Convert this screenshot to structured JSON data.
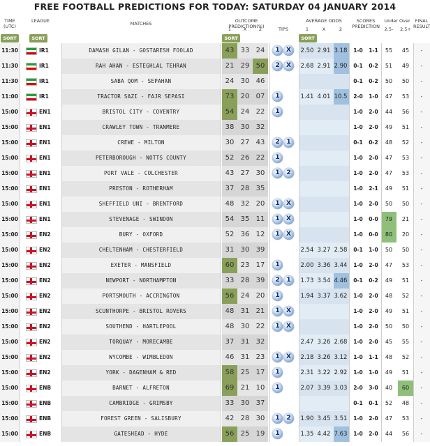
{
  "title": "FREE FOOTBALL PREDICTIONS FOR TODAY: SATURDAY 04 JANUARY 2014",
  "headers": {
    "time": "TIME",
    "utc": "(UTC)",
    "league": "LEAGUE",
    "matches": "MATCHES",
    "outcome": "OUTCOME PREDICTION(%)",
    "o1": "1",
    "ox": "X",
    "o2": "2",
    "tips": "TIPS",
    "odds": "AVERAGE ODDS",
    "a1": "1",
    "ax": "X",
    "a2": "2",
    "scores": "SCORES",
    "prediction": "PREDICTION",
    "underover": "Under Over",
    "u25": "2.5-",
    "o25": "2.5+",
    "final": "FINAL",
    "result": "RESULT",
    "sort": "SORT"
  },
  "colors": {
    "sort_green": "#8aa05a",
    "highlight_green": "#8aa05a",
    "odds_highlight": "#9fc0de",
    "ou_highlight": "#8fc07a"
  },
  "rows": [
    {
      "time": "11:30",
      "flag": "iran",
      "league": "IR1",
      "match": "DAMASH GILAN - GOSTARESH FOOLAD",
      "p": [
        "43",
        "33",
        "24"
      ],
      "hl": 0,
      "tips": [
        "1",
        "X"
      ],
      "odds": [
        "2.50",
        "2.91",
        "3.18"
      ],
      "ohl": true,
      "s1": "1-0",
      "s2": "1-1",
      "u": "55",
      "o": "45",
      "ouhl": -1,
      "final": "-"
    },
    {
      "time": "11:30",
      "flag": "iran",
      "league": "IR1",
      "match": "RAH AHAN - ESTEGHLAL TEHRAN",
      "p": [
        "21",
        "29",
        "50"
      ],
      "hl": 2,
      "tips": [
        "2",
        "X"
      ],
      "odds": [
        "2.68",
        "2.91",
        "2.90"
      ],
      "ohl": true,
      "s1": "0-1",
      "s2": "0-2",
      "u": "51",
      "o": "49",
      "ouhl": -1,
      "final": "-"
    },
    {
      "time": "11:30",
      "flag": "iran",
      "league": "IR1",
      "match": "SABA QOM - SEPAHAN",
      "p": [
        "24",
        "30",
        "46"
      ],
      "hl": -1,
      "tips": [],
      "odds": [
        "",
        "",
        ""
      ],
      "ohl": false,
      "s1": "0-1",
      "s2": "0-2",
      "u": "50",
      "o": "50",
      "ouhl": -1,
      "final": "-"
    },
    {
      "time": "11:00",
      "flag": "iran",
      "league": "IR1",
      "match": "TRACTOR SAZI - FAJR SEPASI",
      "p": [
        "73",
        "20",
        "07"
      ],
      "hl": 0,
      "tips": [
        "1"
      ],
      "odds": [
        "1.41",
        "4.01",
        "10.5"
      ],
      "ohl": true,
      "s1": "2-0",
      "s2": "1-0",
      "u": "47",
      "o": "53",
      "ouhl": -1,
      "final": "-"
    },
    {
      "time": "15:00",
      "flag": "eng",
      "league": "EN1",
      "match": "BRISTOL CITY - COVENTRY",
      "p": [
        "54",
        "24",
        "22"
      ],
      "hl": 0,
      "tips": [
        "1"
      ],
      "odds": [
        "",
        "",
        ""
      ],
      "ohl": false,
      "s1": "1-0",
      "s2": "2-0",
      "u": "44",
      "o": "56",
      "ouhl": -1,
      "final": "-"
    },
    {
      "time": "15:00",
      "flag": "eng",
      "league": "EN1",
      "match": "CRAWLEY TOWN - TRANMERE",
      "p": [
        "38",
        "30",
        "32"
      ],
      "hl": -1,
      "tips": [],
      "odds": [
        "",
        "",
        ""
      ],
      "ohl": false,
      "s1": "1-0",
      "s2": "2-0",
      "u": "49",
      "o": "51",
      "ouhl": -1,
      "final": "-"
    },
    {
      "time": "15:00",
      "flag": "eng",
      "league": "EN1",
      "match": "CREWE - MILTON",
      "p": [
        "30",
        "27",
        "43"
      ],
      "hl": -1,
      "tips": [
        "2",
        "1"
      ],
      "odds": [
        "",
        "",
        ""
      ],
      "ohl": false,
      "s1": "0-1",
      "s2": "0-2",
      "u": "48",
      "o": "52",
      "ouhl": -1,
      "final": "-"
    },
    {
      "time": "15:00",
      "flag": "eng",
      "league": "EN1",
      "match": "PETERBOROUGH - NOTTS COUNTY",
      "p": [
        "52",
        "26",
        "22"
      ],
      "hl": -1,
      "tips": [
        "1"
      ],
      "odds": [
        "",
        "",
        ""
      ],
      "ohl": false,
      "s1": "1-0",
      "s2": "2-0",
      "u": "47",
      "o": "53",
      "ouhl": -1,
      "final": "-"
    },
    {
      "time": "15:00",
      "flag": "eng",
      "league": "EN1",
      "match": "PORT VALE - COLCHESTER",
      "p": [
        "43",
        "27",
        "30"
      ],
      "hl": -1,
      "tips": [
        "1",
        "2"
      ],
      "odds": [
        "",
        "",
        ""
      ],
      "ohl": false,
      "s1": "1-0",
      "s2": "2-0",
      "u": "47",
      "o": "53",
      "ouhl": -1,
      "final": "-"
    },
    {
      "time": "15:00",
      "flag": "eng",
      "league": "EN1",
      "match": "PRESTON - ROTHERHAM",
      "p": [
        "37",
        "28",
        "35"
      ],
      "hl": -1,
      "tips": [],
      "odds": [
        "",
        "",
        ""
      ],
      "ohl": false,
      "s1": "1-0",
      "s2": "2-1",
      "u": "49",
      "o": "51",
      "ouhl": -1,
      "final": "-"
    },
    {
      "time": "15:00",
      "flag": "eng",
      "league": "EN1",
      "match": "SHEFFIELD UNI - BRENTFORD",
      "p": [
        "48",
        "32",
        "20"
      ],
      "hl": -1,
      "tips": [
        "1",
        "X"
      ],
      "odds": [
        "",
        "",
        ""
      ],
      "ohl": false,
      "s1": "1-0",
      "s2": "2-0",
      "u": "50",
      "o": "50",
      "ouhl": -1,
      "final": "-"
    },
    {
      "time": "15:00",
      "flag": "eng",
      "league": "EN1",
      "match": "STEVENAGE - SWINDON",
      "p": [
        "54",
        "35",
        "11"
      ],
      "hl": -1,
      "tips": [
        "1",
        "X"
      ],
      "odds": [
        "",
        "",
        ""
      ],
      "ohl": false,
      "s1": "1-0",
      "s2": "0-0",
      "u": "79",
      "o": "21",
      "ouhl": 0,
      "final": "-"
    },
    {
      "time": "15:00",
      "flag": "eng",
      "league": "EN2",
      "match": "BURY - OXFORD",
      "p": [
        "52",
        "36",
        "12"
      ],
      "hl": -1,
      "tips": [
        "1",
        "X"
      ],
      "odds": [
        "",
        "",
        ""
      ],
      "ohl": false,
      "s1": "1-0",
      "s2": "0-0",
      "u": "80",
      "o": "20",
      "ouhl": 0,
      "final": "-"
    },
    {
      "time": "15:00",
      "flag": "eng",
      "league": "EN2",
      "match": "CHELTENHAM - CHESTERFIELD",
      "p": [
        "31",
        "30",
        "39"
      ],
      "hl": -1,
      "tips": [],
      "odds": [
        "2.54",
        "3.27",
        "2.58"
      ],
      "ohl": false,
      "s1": "0-1",
      "s2": "1-0",
      "u": "50",
      "o": "50",
      "ouhl": -1,
      "final": "-"
    },
    {
      "time": "15:00",
      "flag": "eng",
      "league": "EN2",
      "match": "EXETER - MANSFIELD",
      "p": [
        "60",
        "23",
        "17"
      ],
      "hl": 0,
      "tips": [
        "1"
      ],
      "odds": [
        "2.00",
        "3.36",
        "3.44"
      ],
      "ohl": false,
      "s1": "1-0",
      "s2": "2-0",
      "u": "47",
      "o": "53",
      "ouhl": -1,
      "final": "-"
    },
    {
      "time": "15:00",
      "flag": "eng",
      "league": "EN2",
      "match": "NEWPORT - NORTHAMPTON",
      "p": [
        "33",
        "28",
        "39"
      ],
      "hl": -1,
      "tips": [
        "2",
        "1"
      ],
      "odds": [
        "1.73",
        "3.54",
        "4.46"
      ],
      "ohl": true,
      "s1": "0-1",
      "s2": "0-2",
      "u": "49",
      "o": "51",
      "ouhl": -1,
      "final": "-"
    },
    {
      "time": "15:00",
      "flag": "eng",
      "league": "EN2",
      "match": "PORTSMOUTH - ACCRINGTON",
      "p": [
        "56",
        "24",
        "20"
      ],
      "hl": 0,
      "tips": [
        "1"
      ],
      "odds": [
        "1.94",
        "3.37",
        "3.62"
      ],
      "ohl": false,
      "s1": "1-0",
      "s2": "2-0",
      "u": "48",
      "o": "52",
      "ouhl": -1,
      "final": "-"
    },
    {
      "time": "15:00",
      "flag": "eng",
      "league": "EN2",
      "match": "SCUNTHORPE - BRISTOL ROVERS",
      "p": [
        "48",
        "31",
        "21"
      ],
      "hl": -1,
      "tips": [
        "1",
        "X"
      ],
      "odds": [
        "",
        "",
        ""
      ],
      "ohl": false,
      "s1": "1-0",
      "s2": "2-0",
      "u": "49",
      "o": "51",
      "ouhl": -1,
      "final": "-"
    },
    {
      "time": "15:00",
      "flag": "eng",
      "league": "EN2",
      "match": "SOUTHEND - HARTLEPOOL",
      "p": [
        "48",
        "30",
        "22"
      ],
      "hl": -1,
      "tips": [
        "1",
        "X"
      ],
      "odds": [
        "",
        "",
        ""
      ],
      "ohl": false,
      "s1": "1-0",
      "s2": "2-0",
      "u": "50",
      "o": "50",
      "ouhl": -1,
      "final": "-"
    },
    {
      "time": "15:00",
      "flag": "eng",
      "league": "EN2",
      "match": "TORQUAY - MORECAMBE",
      "p": [
        "37",
        "31",
        "32"
      ],
      "hl": -1,
      "tips": [],
      "odds": [
        "2.47",
        "3.26",
        "2.68"
      ],
      "ohl": false,
      "s1": "1-0",
      "s2": "2-0",
      "u": "45",
      "o": "55",
      "ouhl": -1,
      "final": "-"
    },
    {
      "time": "15:00",
      "flag": "eng",
      "league": "EN2",
      "match": "WYCOMBE - WIMBLEDON",
      "p": [
        "46",
        "31",
        "23"
      ],
      "hl": -1,
      "tips": [
        "1",
        "X"
      ],
      "odds": [
        "2.18",
        "3.26",
        "3.12"
      ],
      "ohl": false,
      "s1": "1-0",
      "s2": "1-1",
      "u": "48",
      "o": "52",
      "ouhl": -1,
      "final": "-"
    },
    {
      "time": "15:00",
      "flag": "eng",
      "league": "EN2",
      "match": "YORK - DAGENHAM & RED",
      "p": [
        "58",
        "25",
        "17"
      ],
      "hl": 0,
      "tips": [
        "1"
      ],
      "odds": [
        "2.31",
        "3.22",
        "2.92"
      ],
      "ohl": false,
      "s1": "1-0",
      "s2": "1-0",
      "u": "49",
      "o": "51",
      "ouhl": -1,
      "final": "-"
    },
    {
      "time": "15:00",
      "flag": "eng",
      "league": "ENB",
      "match": "BARNET - ALFRETON",
      "p": [
        "69",
        "21",
        "10"
      ],
      "hl": 0,
      "tips": [
        "1"
      ],
      "odds": [
        "2.07",
        "3.39",
        "3.03"
      ],
      "ohl": false,
      "s1": "2-0",
      "s2": "3-0",
      "u": "40",
      "o": "60",
      "ouhl": 1,
      "final": "-"
    },
    {
      "time": "15:00",
      "flag": "eng",
      "league": "ENB",
      "match": "CAMBRIDGE - GRIMSBY",
      "p": [
        "33",
        "30",
        "37"
      ],
      "hl": -1,
      "tips": [],
      "odds": [
        "",
        "",
        ""
      ],
      "ohl": false,
      "s1": "0-1",
      "s2": "0-1",
      "u": "52",
      "o": "48",
      "ouhl": -1,
      "final": "-"
    },
    {
      "time": "15:00",
      "flag": "eng",
      "league": "ENB",
      "match": "FOREST GREEN - SALISBURY",
      "p": [
        "42",
        "28",
        "30"
      ],
      "hl": -1,
      "tips": [
        "1",
        "2"
      ],
      "odds": [
        "1.90",
        "3.45",
        "3.51"
      ],
      "ohl": false,
      "s1": "1-0",
      "s2": "2-0",
      "u": "47",
      "o": "53",
      "ouhl": -1,
      "final": "-"
    },
    {
      "time": "15:00",
      "flag": "eng",
      "league": "ENB",
      "match": "GATESHEAD - HYDE",
      "p": [
        "56",
        "25",
        "19"
      ],
      "hl": 0,
      "tips": [
        "1"
      ],
      "odds": [
        "1.35",
        "4.42",
        "7.63"
      ],
      "ohl": true,
      "s1": "1-0",
      "s2": "2-0",
      "u": "44",
      "o": "56",
      "ouhl": -1,
      "final": "-"
    }
  ]
}
